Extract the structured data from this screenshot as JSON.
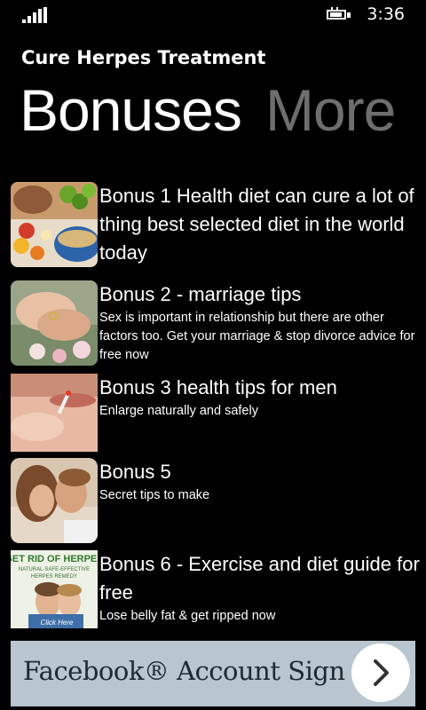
{
  "status": {
    "time": "3:36"
  },
  "app": {
    "title": "Cure Herpes Treatment"
  },
  "pivot": {
    "active": "Bonuses",
    "inactive": "More"
  },
  "items": [
    {
      "title": "Bonus 1 Health diet can cure a lot of thing best selected diet in the world today",
      "description": ""
    },
    {
      "title": "Bonus 2 - marriage tips",
      "description": "Sex is important in relationship but there are other factors too. Get your marriage & stop divorce advice for free now"
    },
    {
      "title": "Bonus 3 health tips for men",
      "description": "Enlarge naturally and safely"
    },
    {
      "title": "Bonus 5",
      "description": "Secret tips to make"
    },
    {
      "title": "Bonus 6 - Exercise and diet guide for free",
      "description": "Lose belly fat & get ripped now"
    }
  ],
  "ad": {
    "text": "Facebook® Account Sign Up"
  },
  "thumb6_text": {
    "line1": "GET RID OF HERPES",
    "line2": "NATURAL·SAFE·EFFECTIVE",
    "line3": "HERPES REMEDY",
    "line4": "Click Here"
  },
  "icons": [
    "signal-icon",
    "battery-icon",
    "chevron-right-icon"
  ]
}
